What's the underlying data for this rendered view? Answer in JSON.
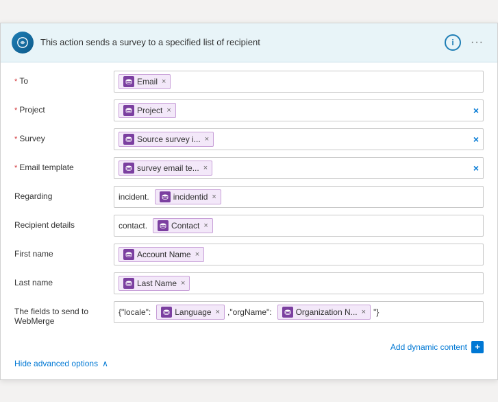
{
  "header": {
    "title": "This action sends a survey to a specified list of recipient",
    "info_label": "i",
    "more_label": "···"
  },
  "fields": [
    {
      "id": "to",
      "label": "* To",
      "required": true,
      "tokens": [
        {
          "text": "Email",
          "hasIcon": true
        }
      ],
      "hasClear": false,
      "prefix": null
    },
    {
      "id": "project",
      "label": "* Project",
      "required": true,
      "tokens": [
        {
          "text": "Project",
          "hasIcon": true
        }
      ],
      "hasClear": true,
      "prefix": null
    },
    {
      "id": "survey",
      "label": "* Survey",
      "required": true,
      "tokens": [
        {
          "text": "Source survey i...",
          "hasIcon": true
        }
      ],
      "hasClear": true,
      "prefix": null
    },
    {
      "id": "email-template",
      "label": "* Email template",
      "required": true,
      "tokens": [
        {
          "text": "survey email te...",
          "hasIcon": true
        }
      ],
      "hasClear": true,
      "prefix": null
    },
    {
      "id": "regarding",
      "label": "Regarding",
      "required": false,
      "tokens": [
        {
          "text": "incidentid",
          "hasIcon": true
        }
      ],
      "hasClear": false,
      "prefix": "incident."
    },
    {
      "id": "recipient-details",
      "label": "Recipient details",
      "required": false,
      "tokens": [
        {
          "text": "Contact",
          "hasIcon": true
        }
      ],
      "hasClear": false,
      "prefix": "contact."
    },
    {
      "id": "first-name",
      "label": "First name",
      "required": false,
      "tokens": [
        {
          "text": "Account Name",
          "hasIcon": true
        }
      ],
      "hasClear": false,
      "prefix": null
    },
    {
      "id": "last-name",
      "label": "Last name",
      "required": false,
      "tokens": [
        {
          "text": "Last Name",
          "hasIcon": true
        }
      ],
      "hasClear": false,
      "prefix": null
    },
    {
      "id": "webmerge",
      "label": "The fields to send to WebMerge",
      "required": false,
      "tokens": [
        {
          "text": "Language",
          "hasIcon": true
        },
        {
          "text": "Organization N...",
          "hasIcon": true
        }
      ],
      "hasClear": false,
      "prefix": null,
      "prefixText": "{\"locale\":",
      "middleText": ",\"orgName\":",
      "suffixText": "\"}"
    }
  ],
  "footer": {
    "add_dynamic_label": "Add dynamic content",
    "add_dynamic_icon": "+",
    "hide_advanced_label": "Hide advanced options",
    "hide_advanced_icon": "∧"
  }
}
